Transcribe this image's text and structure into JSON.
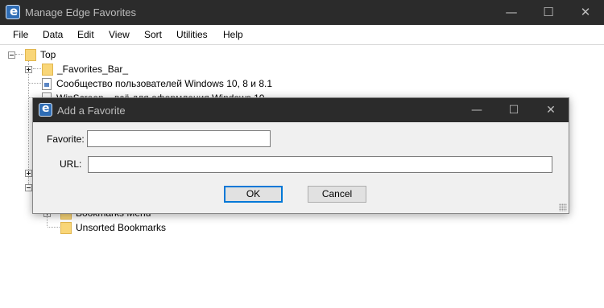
{
  "window": {
    "title": "Manage Edge Favorites",
    "controls": {
      "minimize": "—",
      "maximize": "☐",
      "close": "✕"
    }
  },
  "menu": [
    "File",
    "Data",
    "Edit",
    "View",
    "Sort",
    "Utilities",
    "Help"
  ],
  "tree": {
    "root": "Top",
    "items": [
      {
        "label": "_Favorites_Bar_",
        "type": "folder"
      },
      {
        "label": "Сообщество пользователей Windows 10, 8 и 8.1",
        "type": "page"
      },
      {
        "label": "WinScreen – всё для оформления Windows 10",
        "type": "page"
      },
      {
        "label": "Bookmarks Menu",
        "type": "folder"
      },
      {
        "label": "Unsorted Bookmarks",
        "type": "folder"
      }
    ]
  },
  "dialog": {
    "title": "Add a Favorite",
    "favorite_label": "Favorite:",
    "favorite_value": "",
    "url_label": "URL:",
    "url_value": "",
    "ok_label": "OK",
    "cancel_label": "Cancel",
    "controls": {
      "minimize": "—",
      "maximize": "☐",
      "close": "✕"
    }
  }
}
